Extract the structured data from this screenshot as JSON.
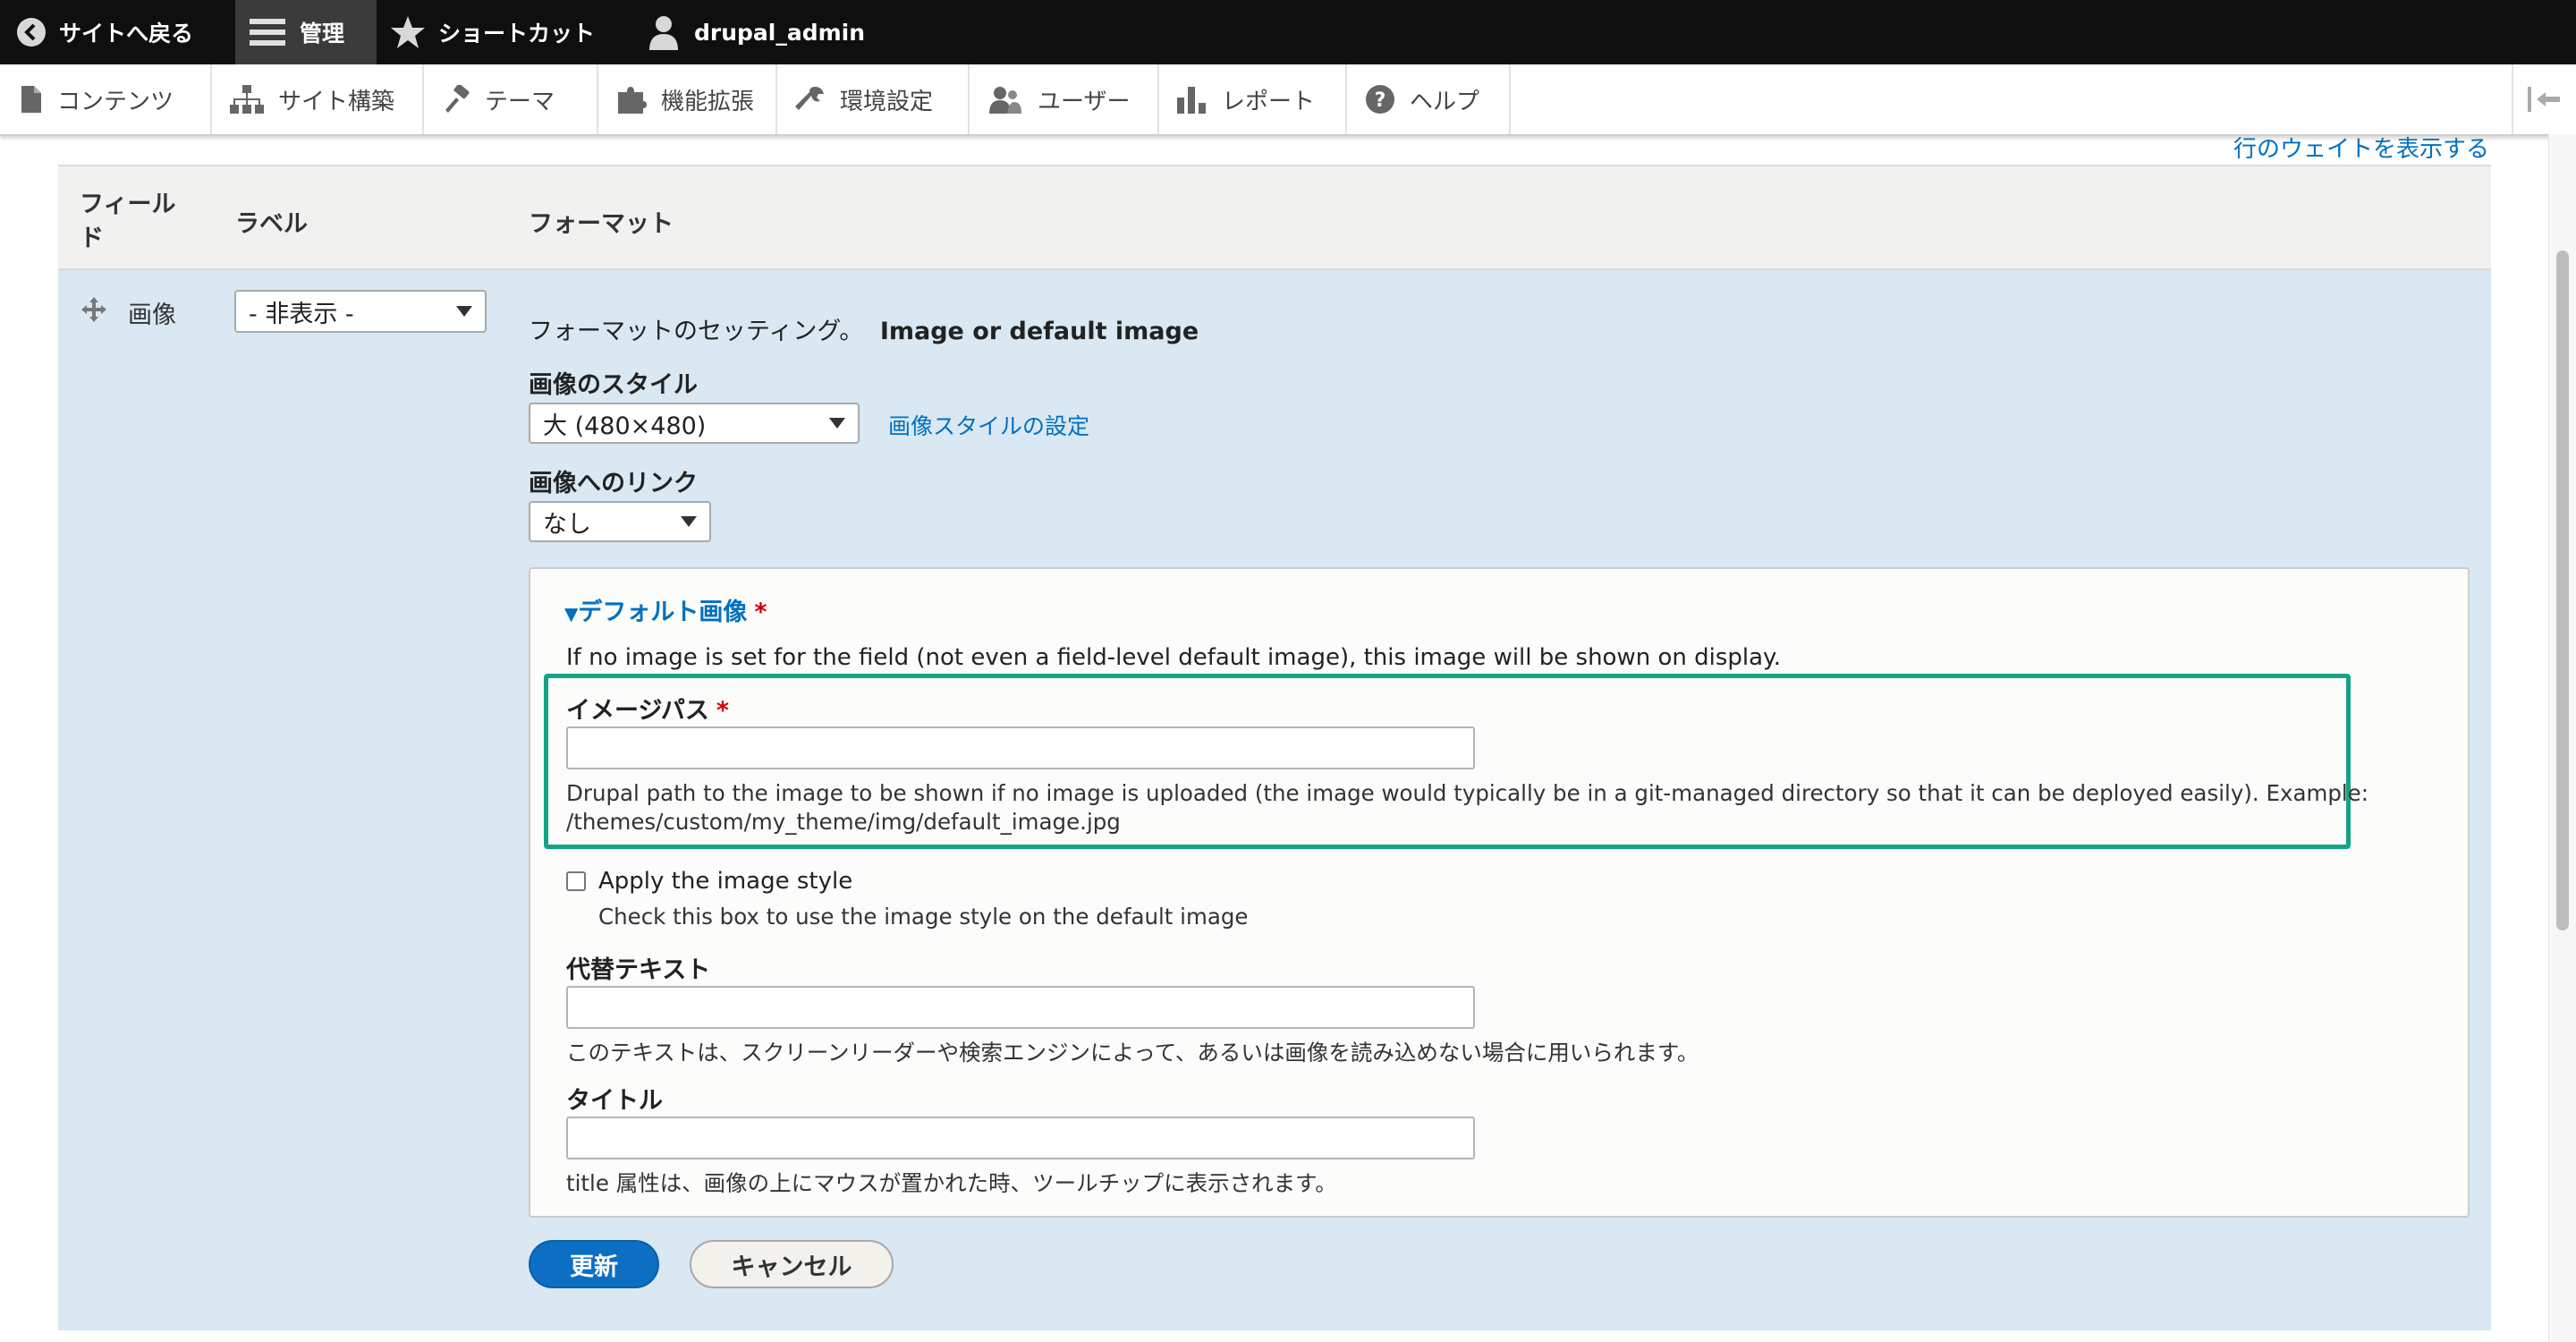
{
  "toolbar": {
    "back": "サイトへ戻る",
    "manage": "管理",
    "shortcuts": "ショートカット",
    "user": "drupal_admin"
  },
  "tray": {
    "items": [
      "コンテンツ",
      "サイト構築",
      "テーマ",
      "機能拡張",
      "環境設定",
      "ユーザー",
      "レポート",
      "ヘルプ"
    ]
  },
  "page": {
    "show_weights": "行のウェイトを表示する"
  },
  "table": {
    "headers": {
      "field": "フィールド",
      "label": "ラベル",
      "format": "フォーマット"
    }
  },
  "row": {
    "field_name": "画像",
    "label_select": "- 非表示 -",
    "format_settings_prefix": "フォーマットのセッティング。",
    "format_name": "Image or default image",
    "image_style_label": "画像のスタイル",
    "image_style_value": "大 (480×480)",
    "image_style_link": "画像スタイルの設定",
    "image_link_label": "画像へのリンク",
    "image_link_value": "なし"
  },
  "details": {
    "summary": "デフォルト画像",
    "required_mark": "*",
    "intro": "If no image is set for the field (not even a field-level default image), this image will be shown on display.",
    "image_path_label": "イメージパス",
    "image_path_value": "",
    "image_path_desc_line1": "Drupal path to the image to be shown if no image is uploaded (the image would typically be in a git-managed directory so that it can be deployed easily). Example:",
    "image_path_desc_line2": "/themes/custom/my_theme/img/default_image.jpg",
    "apply_style_label": "Apply the image style",
    "apply_style_desc": "Check this box to use the image style on the default image",
    "alt_label": "代替テキスト",
    "alt_value": "",
    "alt_desc": "このテキストは、スクリーンリーダーや検索エンジンによって、あるいは画像を読み込めない場合に用いられます。",
    "title_label": "タイトル",
    "title_value": "",
    "title_desc": "title 属性は、画像の上にマウスが置かれた時、ツールチップに表示されます。"
  },
  "buttons": {
    "update": "更新",
    "cancel": "キャンセル"
  },
  "colors": {
    "accent": "#0c6fc4",
    "highlight": "#13a486",
    "row_bg": "#d9e8f2",
    "required": "#cc0000"
  }
}
